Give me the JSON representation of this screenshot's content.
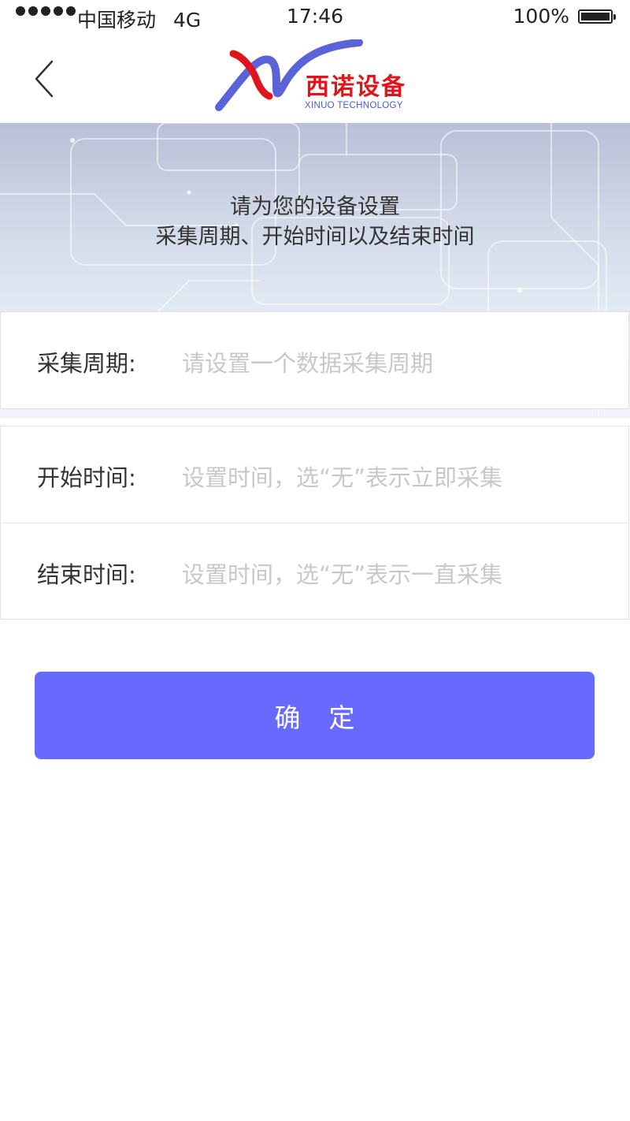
{
  "status_bar": {
    "carrier": "中国移动",
    "network": "4G",
    "time": "17:46",
    "battery": "100%"
  },
  "header": {
    "logo_cn": "西诺设备",
    "logo_en": "XINUO TECHNOLOGY",
    "back_icon": "chevron-left-icon"
  },
  "banner": {
    "line1": "请为您的设备设置",
    "line2": "采集周期、开始时间以及结束时间"
  },
  "form": {
    "period": {
      "label": "采集周期:",
      "placeholder": "请设置一个数据采集周期"
    },
    "start": {
      "label": "开始时间:",
      "placeholder": "设置时间，选“无”表示立即采集"
    },
    "end": {
      "label": "结束时间:",
      "placeholder": "设置时间，选“无”表示一直采集"
    }
  },
  "confirm_button": "确定",
  "colors": {
    "accent": "#6869fd",
    "logo_red": "#e0151b",
    "logo_blue": "#4a5bd0",
    "placeholder": "#c8c8c8"
  }
}
